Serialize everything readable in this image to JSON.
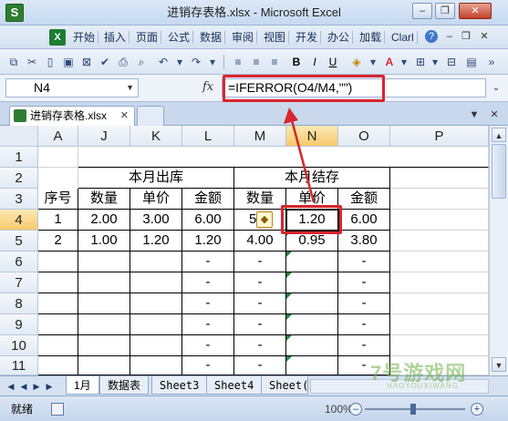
{
  "window": {
    "title": "进销存表格.xlsx - Microsoft Excel",
    "app_icon_letter": "S",
    "buttons": {
      "minimize": "–",
      "restore": "❐",
      "close": "✕"
    }
  },
  "menu": {
    "logo_letter": "X",
    "items": [
      "开始",
      "插入",
      "页面",
      "公式",
      "数据",
      "审阅",
      "视图",
      "开发",
      "办公",
      "加载",
      "Clarl"
    ]
  },
  "formula_bar": {
    "name_box": "N4",
    "fx_label": "fx",
    "formula": "=IFERROR(O4/M4,\"\")"
  },
  "document": {
    "tab_name": "进销存表格.xlsx",
    "close_glyph": "✕"
  },
  "grid": {
    "columns": [
      "A",
      "J",
      "K",
      "L",
      "M",
      "N",
      "O",
      "P"
    ],
    "active_column": "N",
    "rows": [
      "1",
      "2",
      "3",
      "4",
      "5",
      "6",
      "7",
      "8",
      "9",
      "10",
      "11"
    ],
    "active_row": "4",
    "header_out": "本月出库",
    "header_stock": "本月结存",
    "col_labels": [
      "序号",
      "数量",
      "单价",
      "金额",
      "数量",
      "单价",
      "金额"
    ],
    "data_rows": [
      [
        "1",
        "2.00",
        "3.00",
        "6.00",
        "5",
        "1.20",
        "6.00"
      ],
      [
        "2",
        "1.00",
        "1.20",
        "1.20",
        "4.00",
        "0.95",
        "3.80"
      ]
    ],
    "dash": "-"
  },
  "sheets": {
    "tabs": [
      "1月",
      "数据表",
      "Sheet3",
      "Sheet4",
      "Sheet("
    ],
    "active": "1月"
  },
  "status": {
    "text": "就绪",
    "zoom": "100%"
  },
  "watermark": {
    "main": "7号游戏网",
    "sub": "HAOYOUXIWANG"
  },
  "colors": {
    "highlight_red": "#d8262e",
    "error_green": "#1e8a3a"
  }
}
